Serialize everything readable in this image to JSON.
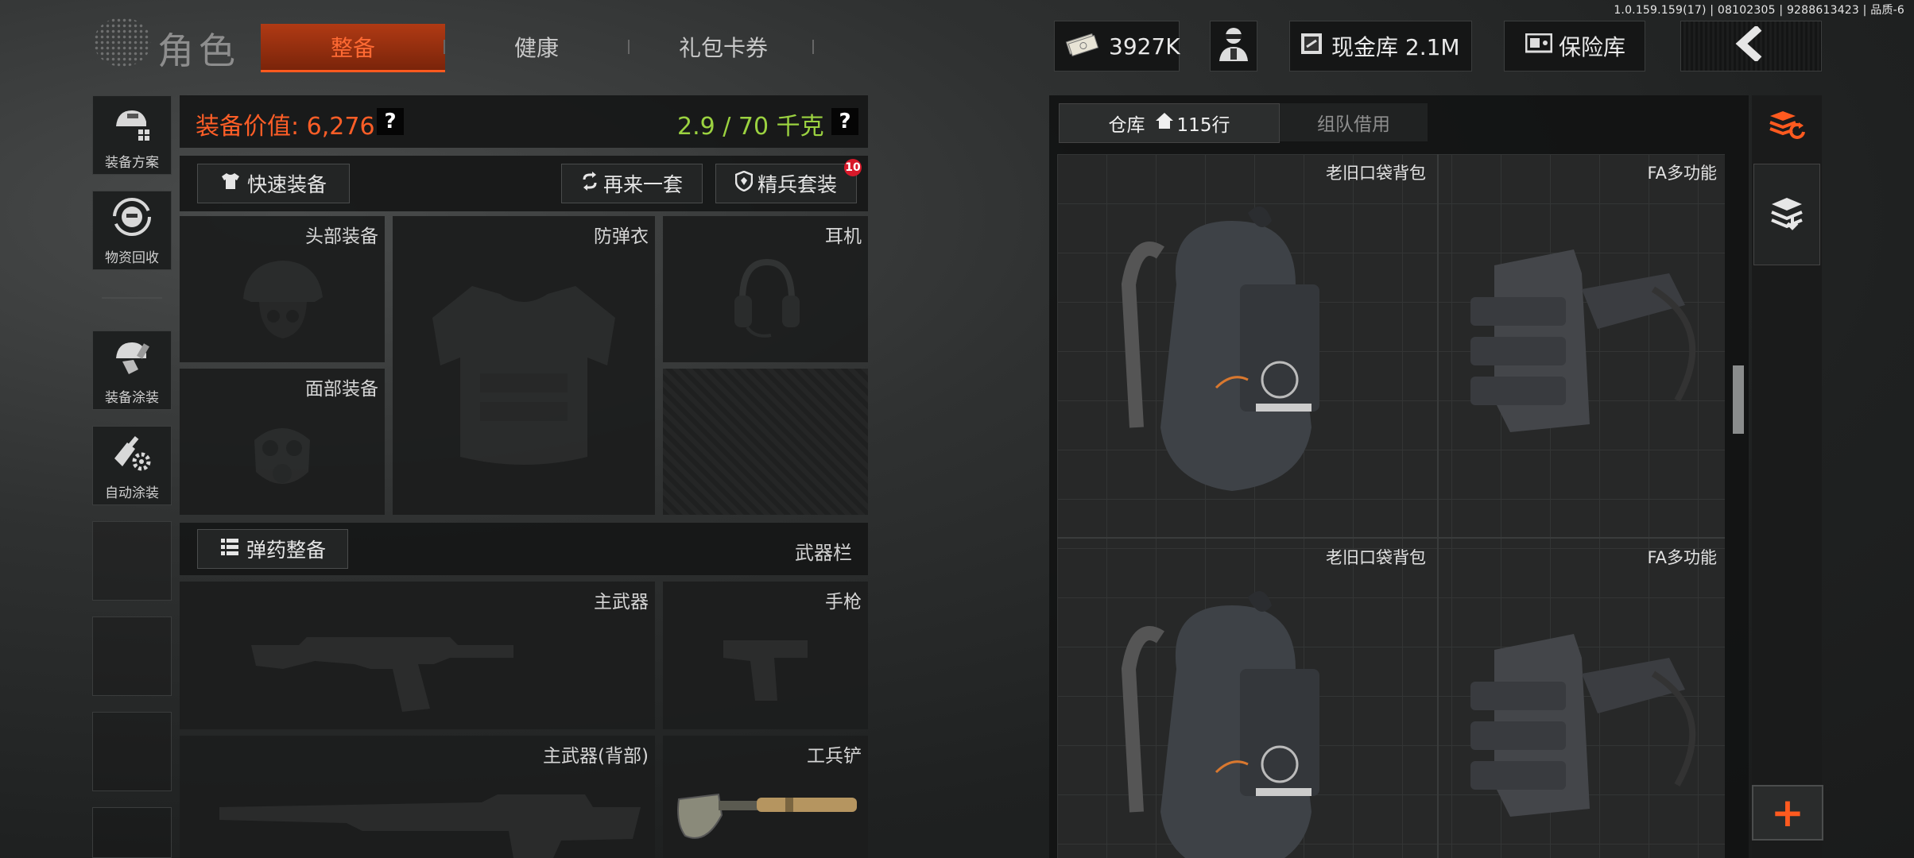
{
  "version": "1.0.159.159(17) | 08102305 | 9288613423 | 品质-6",
  "header": {
    "title": "角色",
    "tabs": [
      {
        "label": "整备",
        "active": true
      },
      {
        "label": "健康",
        "active": false
      },
      {
        "label": "礼包卡券",
        "active": false
      }
    ],
    "currency": "3927K",
    "cash_vault": "现金库 2.1M",
    "safe": "保险库"
  },
  "sidebar": {
    "items": [
      {
        "label": "装备方案",
        "icon": "helmet-plan-icon"
      },
      {
        "label": "物资回收",
        "icon": "recycle-face-icon"
      },
      {
        "label": "装备涂装",
        "icon": "paint-helmet-icon"
      },
      {
        "label": "自动涂装",
        "icon": "auto-paint-icon"
      }
    ]
  },
  "equipment": {
    "value_label": "装备价值: 6,276",
    "weight_label": "2.9 / 70 千克",
    "help": "?",
    "quick_equip": "快速装备",
    "another_set": "再来一套",
    "elite_set": "精兵套装",
    "elite_badge": "10",
    "slots": {
      "head": "头部装备",
      "armor": "防弹衣",
      "headset": "耳机",
      "face": "面部装备"
    },
    "ammo_button": "弹药整备",
    "weapon_bar": "武器栏",
    "weapons": {
      "primary": "主武器",
      "pistol": "手枪",
      "primary_back": "主武器(背部)",
      "shovel": "工兵铲"
    }
  },
  "warehouse": {
    "tabs": [
      {
        "label": "仓库",
        "rows": "115行",
        "active": true
      },
      {
        "label": "组队借用",
        "active": false
      }
    ],
    "items": [
      {
        "name": "老旧口袋背包"
      },
      {
        "name": "FA多功能"
      },
      {
        "name": "老旧口袋背包"
      },
      {
        "name": "FA多功能"
      }
    ],
    "add": "+"
  },
  "colors": {
    "accent": "#ff5a1f",
    "value_orange": "#ff5e27",
    "weight_green": "#9bd240"
  }
}
